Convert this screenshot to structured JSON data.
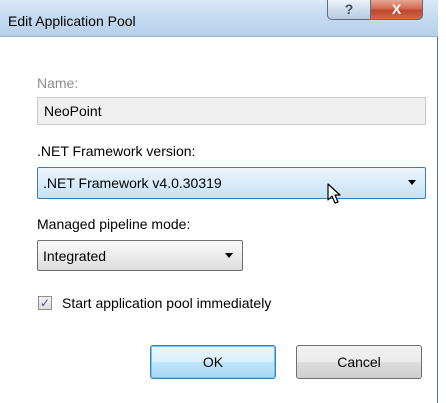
{
  "window": {
    "title": "Edit Application Pool",
    "help_glyph": "?",
    "close_glyph": "X"
  },
  "form": {
    "name_label": "Name:",
    "name_value": "NeoPoint",
    "framework_label": ".NET Framework version:",
    "framework_value": ".NET Framework v4.0.30319",
    "pipeline_label": "Managed pipeline mode:",
    "pipeline_value": "Integrated",
    "start_checkbox_label": "Start application pool immediately",
    "start_checkbox_checked": true
  },
  "buttons": {
    "ok_label": "OK",
    "cancel_label": "Cancel"
  },
  "icons": {
    "mouse_cursor": "arrow-pointer-icon",
    "dropdown_arrow": "chevron-down-icon",
    "check": "checkmark-icon"
  },
  "colors": {
    "titlebar": "#c6dbf1",
    "close_button": "#c0462b",
    "focus_border": "#3c7fb1"
  }
}
